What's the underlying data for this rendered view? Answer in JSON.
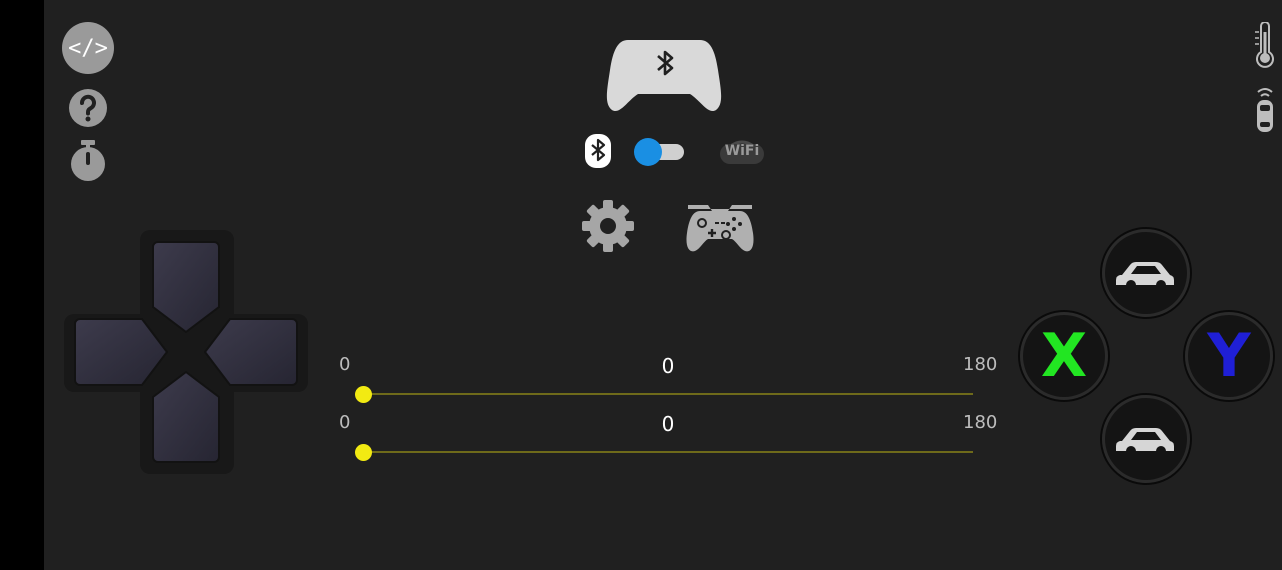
{
  "toolbar": {
    "code_label": "</>",
    "help_icon": "question-icon",
    "timer_icon": "stopwatch-icon"
  },
  "status": {
    "thermometer_icon": "thermometer-icon",
    "car_sensor_icon": "car-sensor-icon"
  },
  "connection": {
    "controller_icon": "bluetooth-controller-icon",
    "bluetooth_icon": "bluetooth-icon",
    "wifi_label": "WiFi",
    "toggle_state": "bluetooth",
    "toggle_color": "#1a8fe3"
  },
  "actions": {
    "settings_icon": "gear-icon",
    "gamepad_icon": "gamepad-icon"
  },
  "sliders": [
    {
      "min": "0",
      "max": "180",
      "value": "0"
    },
    {
      "min": "0",
      "max": "180",
      "value": "0"
    }
  ],
  "buttons": {
    "x_label": "X",
    "y_label": "Y",
    "x_color": "#22e622",
    "y_color": "#1f1fd6",
    "forward_icon": "car-icon",
    "backward_icon": "car-icon"
  },
  "colors": {
    "background": "#202020",
    "slider_thumb": "#f2ea12",
    "slider_track": "#6e6a1a"
  }
}
